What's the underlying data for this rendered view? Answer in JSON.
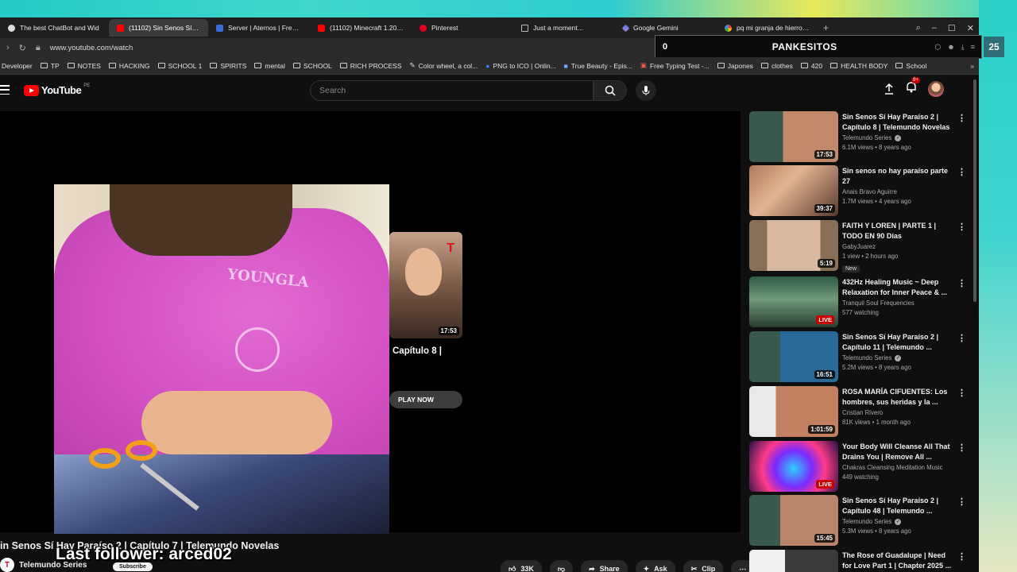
{
  "tabs": [
    {
      "label": "The best ChatBot and Wid",
      "icon": "gpt"
    },
    {
      "label": "(11102) Sin Senos Sí Hay P",
      "icon": "yt",
      "active": true
    },
    {
      "label": "Server | Aternos | Free Mi",
      "icon": "aternos"
    },
    {
      "label": "(11102) Minecraft 1.20 Eas",
      "icon": "yt"
    },
    {
      "label": "Pinterest",
      "icon": "pin"
    },
    {
      "label": "Just a moment...",
      "icon": "page"
    },
    {
      "label": "Google Gemini",
      "icon": "gem"
    },
    {
      "label": "pq mi granja de hierro me",
      "icon": "goog"
    }
  ],
  "address": {
    "url": "www.youtube.com/watch"
  },
  "bookmarks": [
    "Developer",
    "TP",
    "NOTES",
    "HACKING",
    "SCHOOL 1",
    "SPIRITS",
    "mental",
    "SCHOOL",
    "RICH PROCESS",
    "Color wheel, a col...",
    "PNG to ICO | Onlin...",
    "True Beauty - Epis...",
    "Free Typing Test -...",
    "Japones",
    "clothes",
    "420",
    "HEALTH BODY",
    "School"
  ],
  "overlay": {
    "count": "0",
    "name": "PANKESITOS",
    "badge": "25"
  },
  "header": {
    "logo": "YouTube",
    "country": "PE",
    "search_placeholder": "Search",
    "notif_count": "9+"
  },
  "player": {
    "endcard_duration": "17:53",
    "endcard_title": "Capítulo 8 |",
    "play_now": "PLAY NOW"
  },
  "video": {
    "title": "in Senos Sí Hay Paraíso 2 | Capítulo 7 | Telemundo Novelas",
    "channel": "Telemundo Series",
    "subscribe": "Subscribe",
    "likes": "33K",
    "share": "Share",
    "ask": "Ask",
    "clip": "Clip"
  },
  "stream_overlay": {
    "last_follower": "Last follower: arced02"
  },
  "recommendations": [
    {
      "title": "Sin Senos Sí Hay Paraíso 2 | Capítulo 8 | Telemundo Novelas",
      "channel": "Telemundo Series",
      "verified": true,
      "meta": "6.1M views • 8 years ago",
      "duration": "17:53"
    },
    {
      "title": "Sin senos no hay paraíso parte 27",
      "channel": "Anais Bravo Aguirre",
      "verified": false,
      "meta": "1.7M views • 4 years ago",
      "duration": "39:37"
    },
    {
      "title": "FAITH Y LOREN | PARTE 1 | TODO EN 90 Días",
      "channel": "GabyJuarez",
      "verified": false,
      "meta": "1 view • 2 hours ago",
      "duration": "5:19",
      "badge": "New"
    },
    {
      "title": "432Hz Healing Music ~ Deep Relaxation for Inner Peace & ...",
      "channel": "Tranquil Soul Frequencies",
      "verified": false,
      "meta": "577 watching",
      "live": "LIVE"
    },
    {
      "title": "Sin Senos Sí Hay Paraíso 2 | Capítulo 11 | Telemundo ...",
      "channel": "Telemundo Series",
      "verified": true,
      "meta": "5.2M views • 8 years ago",
      "duration": "16:51"
    },
    {
      "title": "ROSA MARÍA CIFUENTES: Los hombres, sus heridas y la ...",
      "channel": "Cristian Rivero",
      "verified": false,
      "meta": "81K views • 1 month ago",
      "duration": "1:01:59"
    },
    {
      "title": "Your Body Will Cleanse All That Drains You | Remove All ...",
      "channel": "Chakras Cleansing Meditation Music",
      "verified": false,
      "meta": "449 watching",
      "live": "LIVE"
    },
    {
      "title": "Sin Senos Sí Hay Paraíso 2 | Capítulo 48 | Telemundo ...",
      "channel": "Telemundo Series",
      "verified": true,
      "meta": "5.3M views • 8 years ago",
      "duration": "15:45"
    },
    {
      "title": "The Rose of Guadalupe | Need for Love Part 1 | Chapter 2025 ...",
      "channel": "",
      "verified": false,
      "meta": ""
    }
  ]
}
